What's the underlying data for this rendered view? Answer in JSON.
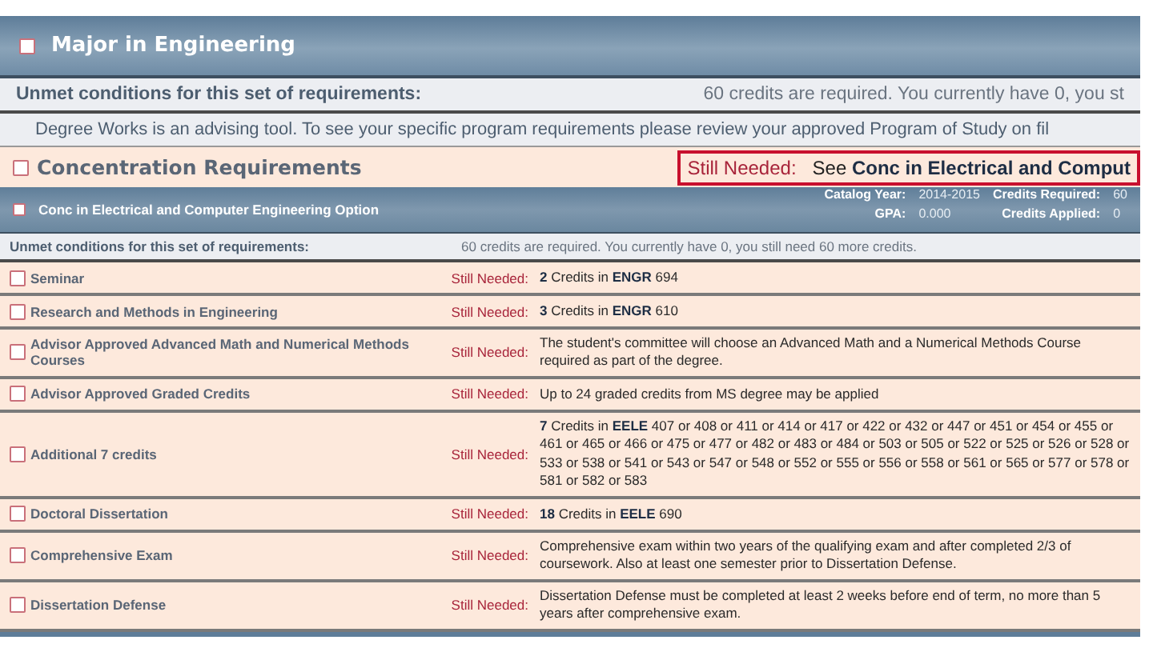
{
  "major": {
    "title": "Major in Engineering",
    "checked": false
  },
  "unmet": {
    "label": "Unmet conditions for this set of requirements:",
    "text": "60 credits are required. You currently have 0,  you st"
  },
  "notice": "Degree Works is an advising tool. To see your specific program requirements please review your approved Program of Study on fil",
  "concentration": {
    "title": "Concentration Requirements",
    "checked": false,
    "status": "Still Needed:",
    "detail": "See **Conc in Electrical and Comput**"
  },
  "option": {
    "title": "Conc in Electrical and Computer Engineering Option",
    "checked": false,
    "stats": [
      {
        "label": "Catalog Year:",
        "value": "2014-2015"
      },
      {
        "label": "Credits Required:",
        "value": "60"
      },
      {
        "label": "GPA:",
        "value": "0.000"
      },
      {
        "label": "Credits Applied:",
        "value": "0"
      }
    ],
    "unmet_label": "Unmet conditions for this set of requirements:",
    "unmet_text": "60 credits are required. You currently have 0,  you still need 60 more credits.",
    "requirements": [
      {
        "name": "Seminar",
        "checked": false,
        "status": "Still Needed:",
        "detail": "**2** Credits in **ENGR** 694"
      },
      {
        "name": "Research and Methods in Engineering",
        "checked": false,
        "status": "Still Needed:",
        "detail": "**3** Credits in **ENGR** 610"
      },
      {
        "name": "Advisor Approved Advanced Math and Numerical Methods Courses",
        "checked": false,
        "status": "Still Needed:",
        "detail": "The student's committee will choose an Advanced Math and a Numerical Methods Course required as part of the degree."
      },
      {
        "name": "Advisor Approved Graded Credits",
        "checked": false,
        "status": "Still Needed:",
        "detail": "Up to 24 graded credits from MS degree may be applied"
      },
      {
        "name": "Additional 7 credits",
        "checked": false,
        "status": "Still Needed:",
        "detail": "**7** Credits in **EELE** 407 or 408 or 411 or 414 or 417 or 422 or 432 or 447 or 451 or 454 or 455 or 461 or 465 or 466 or 475 or 477 or 482 or 483 or 484 or 503 or 505 or 522 or 525 or 526 or 528 or 533 or 538 or 541 or 543 or 547 or 548 or 552 or 555 or 556 or 558 or 561 or 565 or 577 or 578 or 581 or 582 or 583"
      },
      {
        "name": "Doctoral Dissertation",
        "checked": false,
        "status": "Still Needed:",
        "detail": "**18** Credits in **EELE** 690"
      },
      {
        "name": "Comprehensive Exam",
        "checked": false,
        "status": "Still Needed:",
        "detail": "Comprehensive exam within two years of the qualifying exam and after completed 2/3 of coursework. Also at least one semester prior to Dissertation Defense."
      },
      {
        "name": "Dissertation Defense",
        "checked": false,
        "status": "Still Needed:",
        "detail": "Dissertation Defense must be completed at least 2 weeks before end of term, no more than 5 years after comprehensive exam."
      }
    ]
  }
}
